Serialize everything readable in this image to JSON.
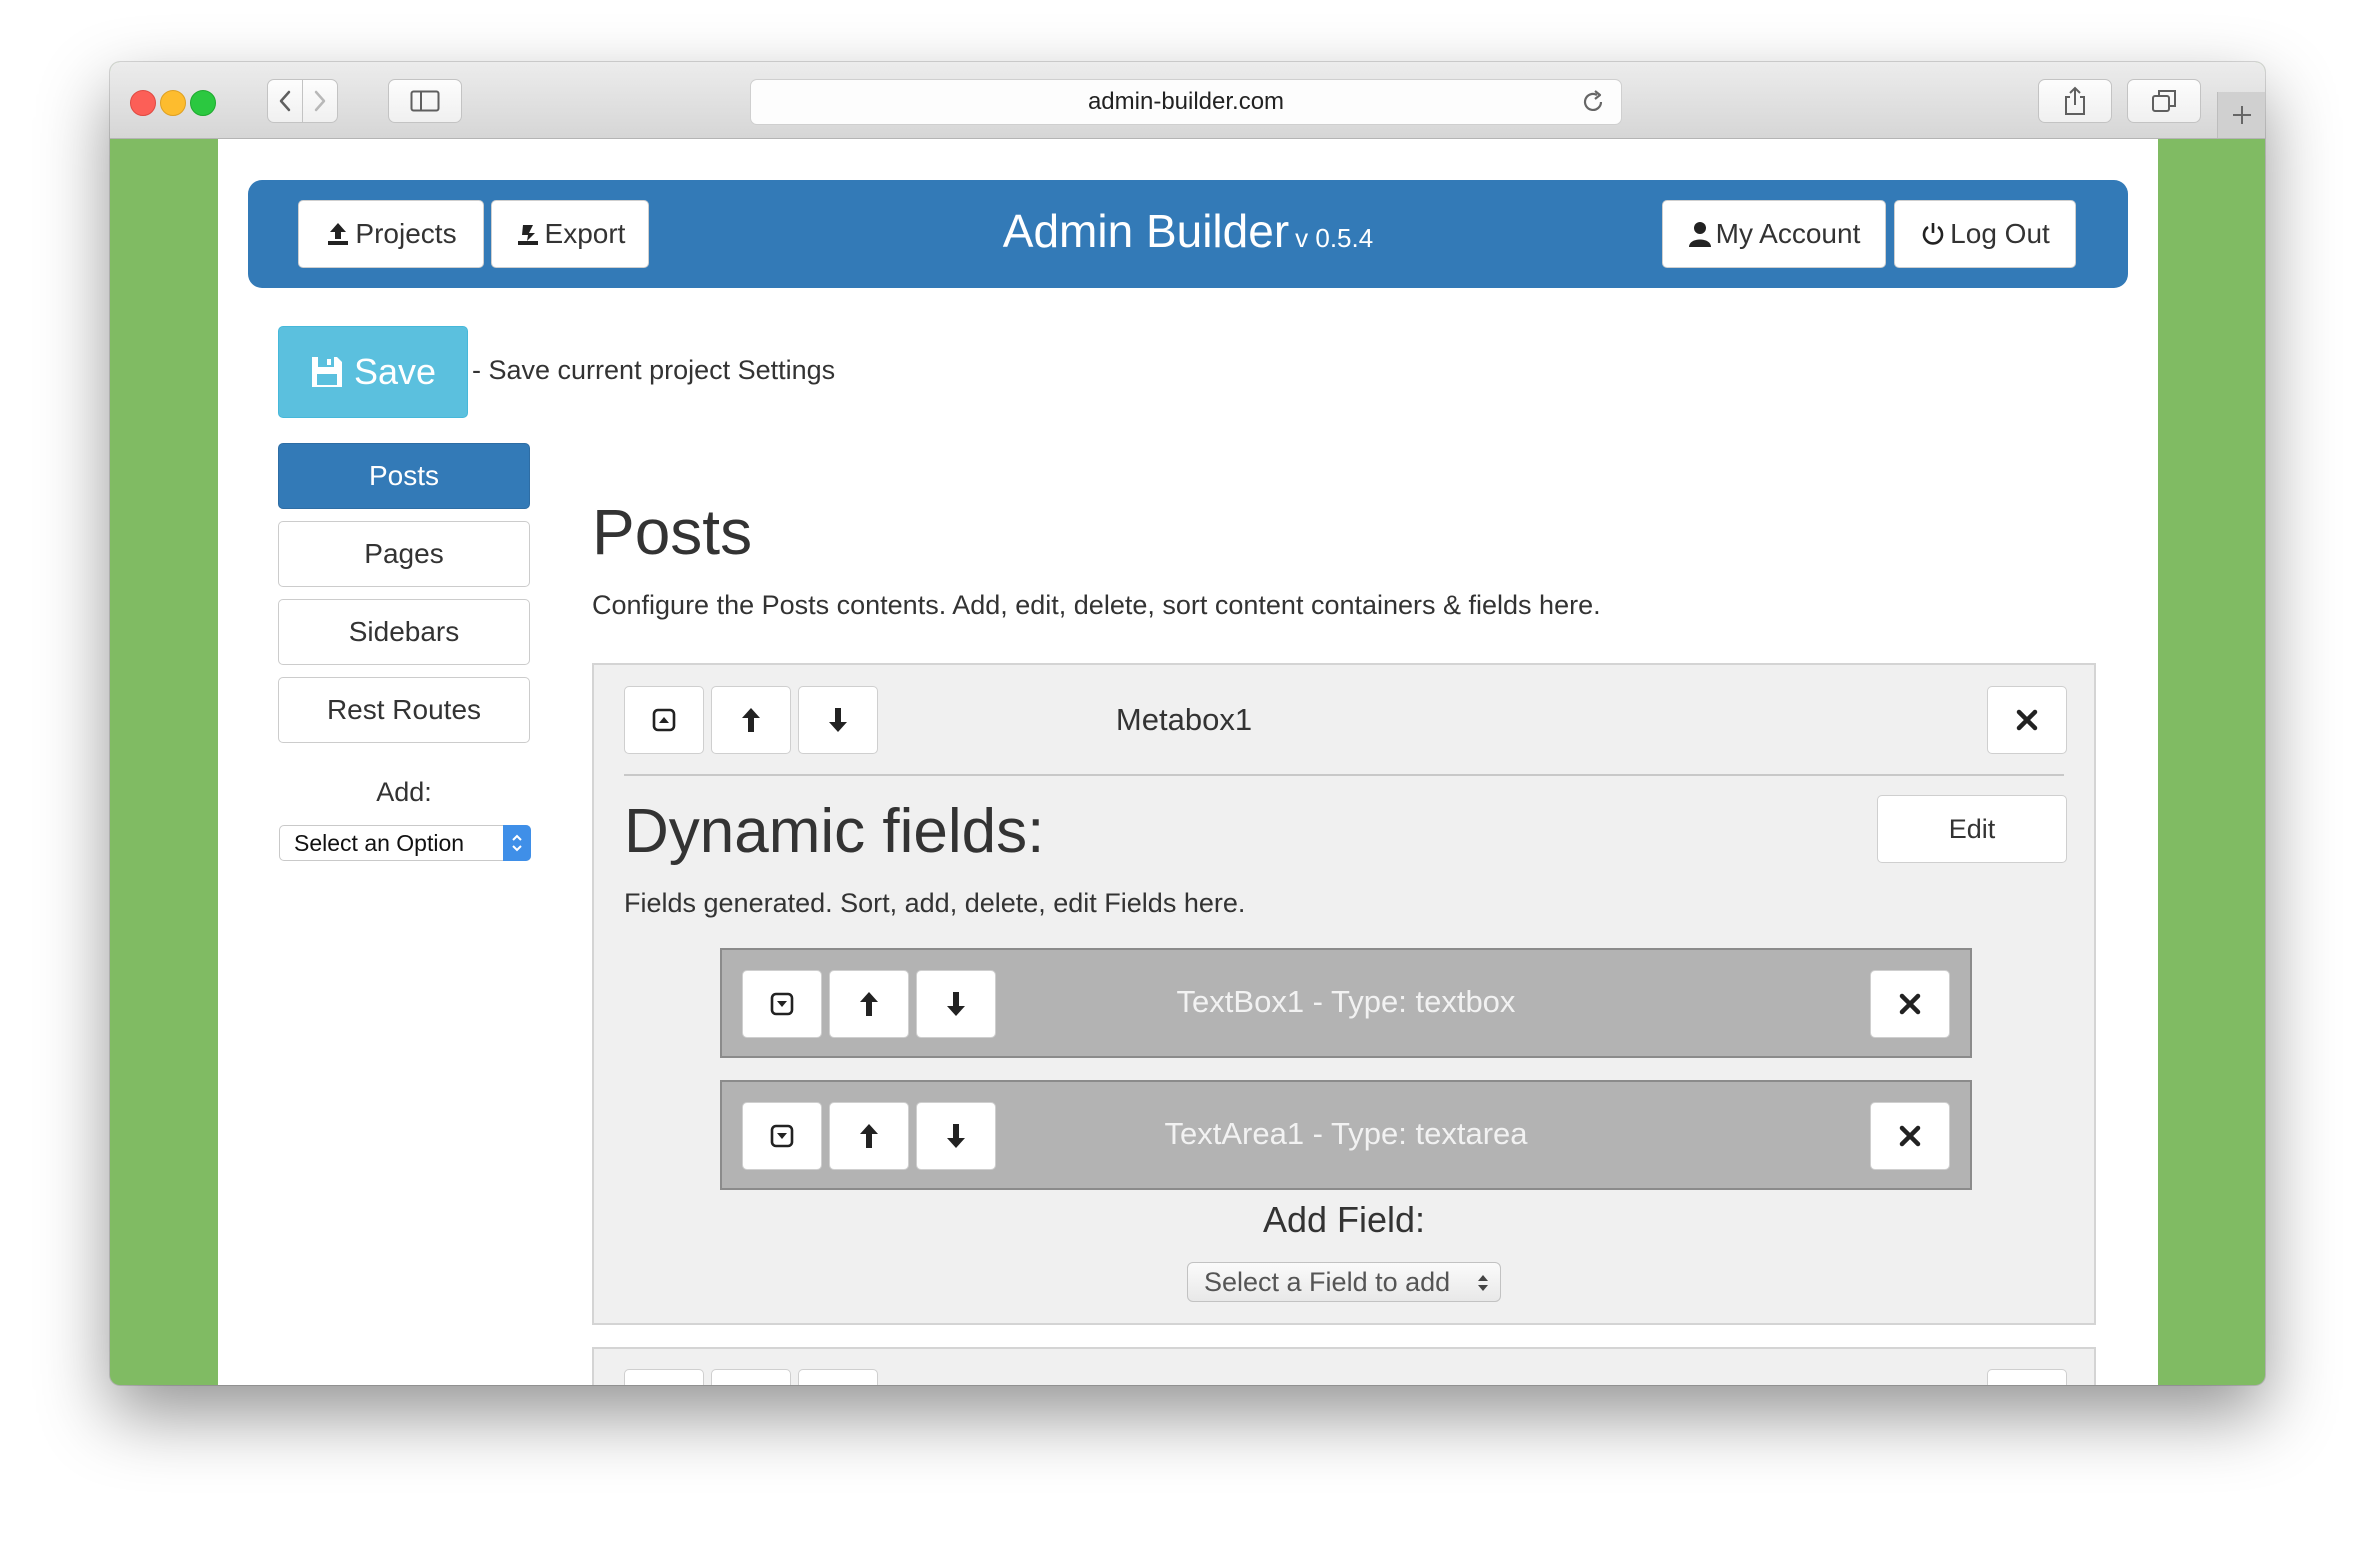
{
  "browser": {
    "url": "admin-builder.com"
  },
  "header": {
    "projects_label": "Projects",
    "export_label": "Export",
    "title": "Admin Builder",
    "version": "v 0.5.4",
    "account_label": "My Account",
    "logout_label": "Log Out",
    "accent_color": "#337ab7"
  },
  "save": {
    "label": "Save",
    "description": "- Save current project Settings"
  },
  "sidebar": {
    "items": [
      {
        "label": "Posts",
        "active": true
      },
      {
        "label": "Pages",
        "active": false
      },
      {
        "label": "Sidebars",
        "active": false
      },
      {
        "label": "Rest Routes",
        "active": false
      }
    ],
    "add_label": "Add:",
    "select_value": "Select an Option"
  },
  "main": {
    "title": "Posts",
    "description": "Configure the Posts contents. Add, edit, delete, sort content containers & fields here.",
    "metabox": {
      "title": "Metabox1",
      "dynamic_title": "Dynamic fields:",
      "edit_label": "Edit",
      "fields_description": "Fields generated. Sort, add, delete, edit Fields here.",
      "fields": [
        {
          "title": "TextBox1 - Type: textbox"
        },
        {
          "title": "TextArea1 - Type: textarea"
        }
      ],
      "add_field_label": "Add Field:",
      "add_field_select": "Select a Field to add"
    }
  },
  "icons": [
    "upload-icon",
    "export-icon",
    "user-icon",
    "power-icon",
    "floppy-icon",
    "collapse-icon",
    "expand-icon",
    "arrow-up-icon",
    "arrow-down-icon",
    "close-icon"
  ]
}
